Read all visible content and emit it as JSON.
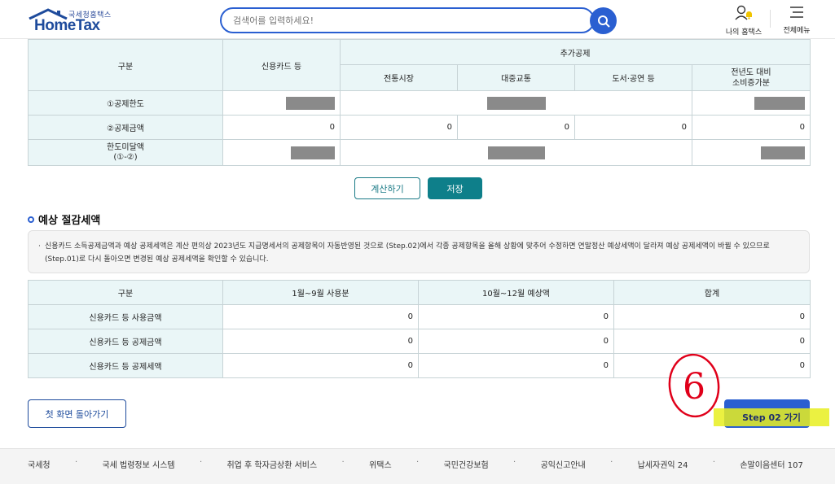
{
  "header": {
    "logo_small": "국세청홈택스",
    "logo_main": "HomeTax",
    "search_placeholder": "검색어를 입력하세요!",
    "my_hometax": "나의 홈택스",
    "all_menu": "전체메뉴"
  },
  "table1": {
    "headers": {
      "category": "구분",
      "credit_card": "신용카드 등",
      "additional": "추가공제",
      "market": "전통시장",
      "transit": "대중교통",
      "culture": "도서·공연 등",
      "increase_line1": "전년도 대비",
      "increase_line2": "소비증가분"
    },
    "rows": [
      {
        "label": "①공제한도"
      },
      {
        "label": "②공제금액",
        "values": [
          "0",
          "0",
          "0",
          "0",
          "0"
        ]
      },
      {
        "label_line1": "한도미달액",
        "label_line2": "(①-②)"
      }
    ]
  },
  "buttons": {
    "calculate": "계산하기",
    "save": "저장",
    "home": "첫 화면 돌아가기",
    "step2": "Step 02 가기"
  },
  "section": {
    "title": "예상 절감세액",
    "notice": "신용카드 소득공제금액과 예상 공제세액은 계산 편의상 2023년도 지급명세서의 공제항목이 자동반영된 것으로 (Step.02)에서 각종 공제항목을 올해 상황에 맞추어 수정하면 연말정산 예상세액이 달라져 예상 공제세액이 바뀔 수 있으므로 (Step.01)로 다시 돌아오면 변경된 예상 공제세액을 확인할 수 있습니다."
  },
  "table2": {
    "headers": [
      "구분",
      "1월~9월 사용분",
      "10월~12월 예상액",
      "합계"
    ],
    "rows": [
      {
        "label": "신용카드 등 사용금액",
        "values": [
          "0",
          "0",
          "0"
        ]
      },
      {
        "label": "신용카드 등 공제금액",
        "values": [
          "0",
          "0",
          "0"
        ]
      },
      {
        "label": "신용카드 등 공제세액",
        "values": [
          "0",
          "0",
          "0"
        ]
      }
    ]
  },
  "annotation": {
    "number": "6",
    "color": "#e0001a",
    "highlight_color": "#e8ee20"
  },
  "footer": {
    "links": [
      "국세청",
      "국세 법령정보 시스템",
      "취업 후 학자금상환 서비스",
      "위택스",
      "국민건강보험",
      "공익신고안내",
      "납세자권익 24",
      "손말이음센터 107"
    ]
  },
  "colors": {
    "brand_blue": "#2a5fd1",
    "teal": "#0e7f8a",
    "header_bg": "#eaf6f7"
  }
}
